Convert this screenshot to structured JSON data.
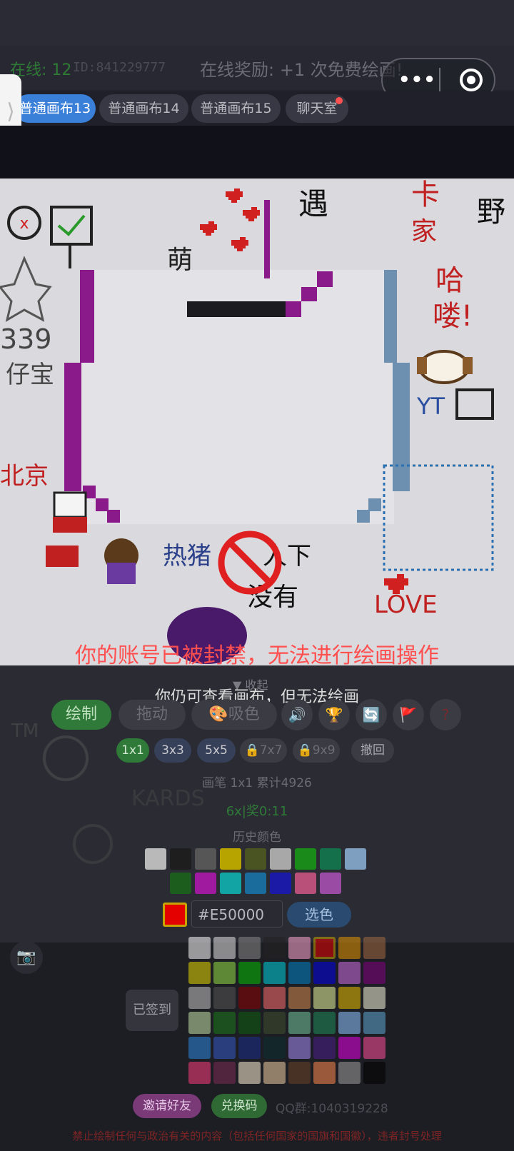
{
  "header": {
    "online": "在线: 12",
    "user_id": "ID:841229777",
    "reward": "在线奖励: +1 次免费绘画!",
    "capsule_more": "•••"
  },
  "tabs": [
    {
      "label": "普通画布13",
      "active": true
    },
    {
      "label": "普通画布14",
      "active": false
    },
    {
      "label": "普通画布15",
      "active": false
    },
    {
      "label": "聊天室",
      "active": false
    }
  ],
  "side_handle": "⟩",
  "canvas": {
    "texts": [
      "遇",
      "哈",
      "喽!",
      "卡",
      "家",
      "野",
      "萌",
      "339",
      "仔宝",
      "北京",
      "热",
      "猪",
      "人下",
      "没有",
      "LOVE",
      "YT",
      "TM",
      "KARDS"
    ]
  },
  "ban": {
    "message": "你的账号已被封禁，无法进行绘画操作",
    "sub_message": "你仍可查看画布，但无法绘画",
    "collapse": "▼ 收起"
  },
  "modes": {
    "draw": "绘制",
    "drag": "拖动",
    "picker": "🎨吸色"
  },
  "icons": [
    "speaker-icon",
    "trophy-icon",
    "refresh-icon",
    "flag-icon",
    "help-icon"
  ],
  "brush_sizes": [
    {
      "label": "1x1",
      "active": true
    },
    {
      "label": "3x3",
      "active": false
    },
    {
      "label": "5x5",
      "active": false
    },
    {
      "label": "🔒7x7",
      "locked": true
    },
    {
      "label": "🔒9x9",
      "locked": true
    },
    {
      "label": "撤回",
      "active": false
    }
  ],
  "brush_info": "画笔 1x1   累计4926",
  "bonus": "6x|奖0:11",
  "history_label": "历史颜色",
  "history_colors_row1": [
    "#b9b9b9",
    "#1e1e1e",
    "#565656",
    "#b8a400",
    "#4a5422",
    "#a8a8a8",
    "#1a8a1a",
    "#14704a",
    "#7f9fc0"
  ],
  "history_colors_row2": [
    "#1c5c1c",
    "#a01aa0",
    "#12a4a4",
    "#1a6c9c",
    "#1a1aa6",
    "#b8507a",
    "#9a4ca4"
  ],
  "current_color": "#E50000",
  "color_input": "#E50000",
  "pick_button": "选色",
  "checked_in": "已签到",
  "palette": [
    [
      "#ffffff",
      "#e4e4e4",
      "#888888",
      "#222222",
      "#ffa7d1",
      "#e50000",
      "#e59500",
      "#a06a42"
    ],
    [
      "#e5d900",
      "#94e044",
      "#02be01",
      "#00d3dd",
      "#0083c7",
      "#0000ea",
      "#cf6ee4",
      "#820080"
    ],
    [
      "#c4c4c4",
      "#555555",
      "#8b0000",
      "#ff6b6b",
      "#d68a4c",
      "#e9f59b",
      "#e9c000",
      "#f5f5dc"
    ],
    [
      "#c5e1a5",
      "#1b7a1b",
      "#0e5e0e",
      "#3f4f2f",
      "#74c69d",
      "#1f8a5a",
      "#8ec5ff",
      "#5fa8d3"
    ],
    [
      "#2e86de",
      "#3457c4",
      "#1a2f8a",
      "#0b2f2f",
      "#a58af5",
      "#4b1d8a",
      "#e100e1",
      "#ff4f9a"
    ],
    [
      "#ff3c7d",
      "#7a2c52",
      "#fff3d6",
      "#f2d0a4",
      "#6b4226",
      "#ff8a4c",
      "#9e9e9e",
      "#000000"
    ]
  ],
  "invite": "邀请好友",
  "redeem": "兑换码",
  "qq_group": "QQ群:1040319228",
  "rule": "禁止绘制任何与政治有关的内容（包括任何国家的国旗和国徽），违者封号处理",
  "colors": {
    "accent": "#3a7fd8",
    "ban_red": "#ff4f4f",
    "draw_green": "#2f8f3a"
  }
}
